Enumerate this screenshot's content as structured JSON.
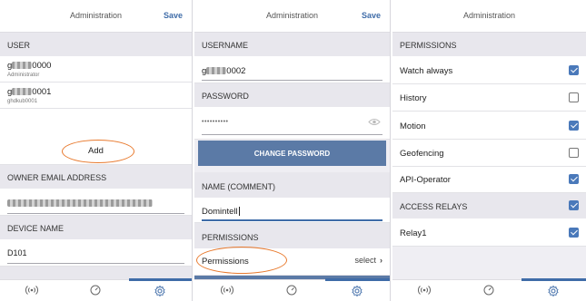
{
  "panel1": {
    "title": "Administration",
    "save_label": "Save",
    "user_section": "USER",
    "users": [
      {
        "name_suffix": "0000",
        "sub": "Administrator",
        "name_prefix": "g"
      },
      {
        "name_suffix": "0001",
        "sub": "ghdkub0001",
        "name_prefix": "g"
      }
    ],
    "add_label": "Add",
    "owner_email_section": "OWNER EMAIL ADDRESS",
    "device_name_section": "DEVICE NAME",
    "device_name_value": "D101",
    "tabs": [
      "broadcast-icon",
      "gauge-icon",
      "gear-icon"
    ]
  },
  "panel2": {
    "title": "Administration",
    "save_label": "Save",
    "username_section": "USERNAME",
    "username_prefix": "g",
    "username_suffix": "0002",
    "password_section": "PASSWORD",
    "password_value": "••••••••••",
    "change_password_label": "CHANGE PASSWORD",
    "name_section": "NAME (COMMENT)",
    "name_value": "Domintell",
    "permissions_section": "PERMISSIONS",
    "permissions_label": "Permissions",
    "permissions_select": "select"
  },
  "panel3": {
    "title": "Administration",
    "permissions_section": "PERMISSIONS",
    "permissions": [
      {
        "label": "Watch always",
        "checked": true
      },
      {
        "label": "History",
        "checked": false
      },
      {
        "label": "Motion",
        "checked": true
      },
      {
        "label": "Geofencing",
        "checked": false
      },
      {
        "label": "API-Operator",
        "checked": true
      }
    ],
    "relays_section": "ACCESS RELAYS",
    "relays_checked": true,
    "relays": [
      {
        "label": "Relay1",
        "checked": true
      }
    ]
  },
  "colors": {
    "accent": "#3f6ca8",
    "highlight_oval": "#e8792d",
    "button_bg": "#5b7aa6",
    "checkbox_on": "#4a79ba"
  }
}
